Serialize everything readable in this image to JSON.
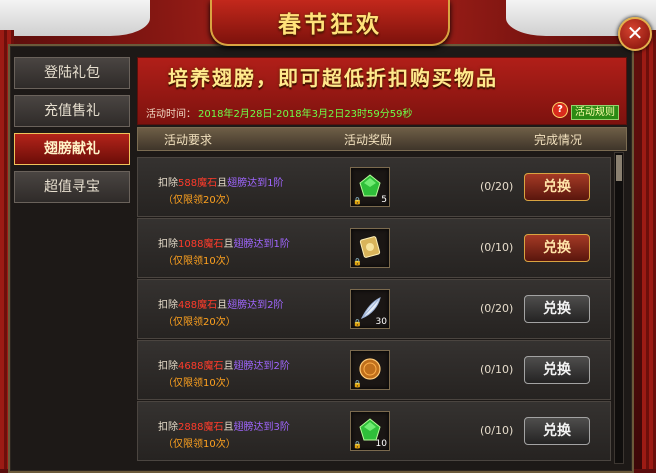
{
  "window": {
    "title": "春节狂欢",
    "close_label": "✕"
  },
  "sidebar": {
    "items": [
      {
        "label": "登陆礼包",
        "active": false
      },
      {
        "label": "充值售礼",
        "active": false
      },
      {
        "label": "翅膀献礼",
        "active": true
      },
      {
        "label": "超值寻宝",
        "active": false
      }
    ]
  },
  "banner": {
    "title": "培养翅膀，即可超低折扣购买物品",
    "time_label": "活动时间：",
    "time_value": "2018年2月28日-2018年3月2日23时59分59秒",
    "rules_label": "活动规则"
  },
  "table": {
    "headers": {
      "requirement": "活动要求",
      "reward": "活动奖励",
      "status": "完成情况"
    },
    "rows": [
      {
        "deduct": "扣除",
        "amount": "588魔石",
        "mid": "且",
        "wing": "翅膀达到1阶",
        "limit": "（仅限领20次）",
        "item": "green-gem",
        "qty": "5",
        "count": "(0/20)",
        "button": "兑换",
        "button_style": "red"
      },
      {
        "deduct": "扣除",
        "amount": "1088魔石",
        "mid": "且",
        "wing": "翅膀达到1阶",
        "limit": "（仅限领10次）",
        "item": "gold-card",
        "qty": "",
        "count": "(0/10)",
        "button": "兑换",
        "button_style": "red"
      },
      {
        "deduct": "扣除",
        "amount": "488魔石",
        "mid": "且",
        "wing": "翅膀达到2阶",
        "limit": "（仅限领20次）",
        "item": "white-feather",
        "qty": "30",
        "count": "(0/20)",
        "button": "兑换",
        "button_style": "gray"
      },
      {
        "deduct": "扣除",
        "amount": "4688魔石",
        "mid": "且",
        "wing": "翅膀达到2阶",
        "limit": "（仅限领10次）",
        "item": "bronze-coin",
        "qty": "",
        "count": "(0/10)",
        "button": "兑换",
        "button_style": "gray"
      },
      {
        "deduct": "扣除",
        "amount": "2888魔石",
        "mid": "且",
        "wing": "翅膀达到3阶",
        "limit": "（仅限领10次）",
        "item": "green-gem",
        "qty": "10",
        "count": "(0/10)",
        "button": "兑换",
        "button_style": "gray"
      }
    ]
  },
  "colors": {
    "accent_gold": "#ffe27a",
    "time_green": "#6dff4a",
    "amount_red": "#ff3b2b",
    "wing_purple": "#a066ff",
    "limit_orange": "#ffa21f"
  }
}
